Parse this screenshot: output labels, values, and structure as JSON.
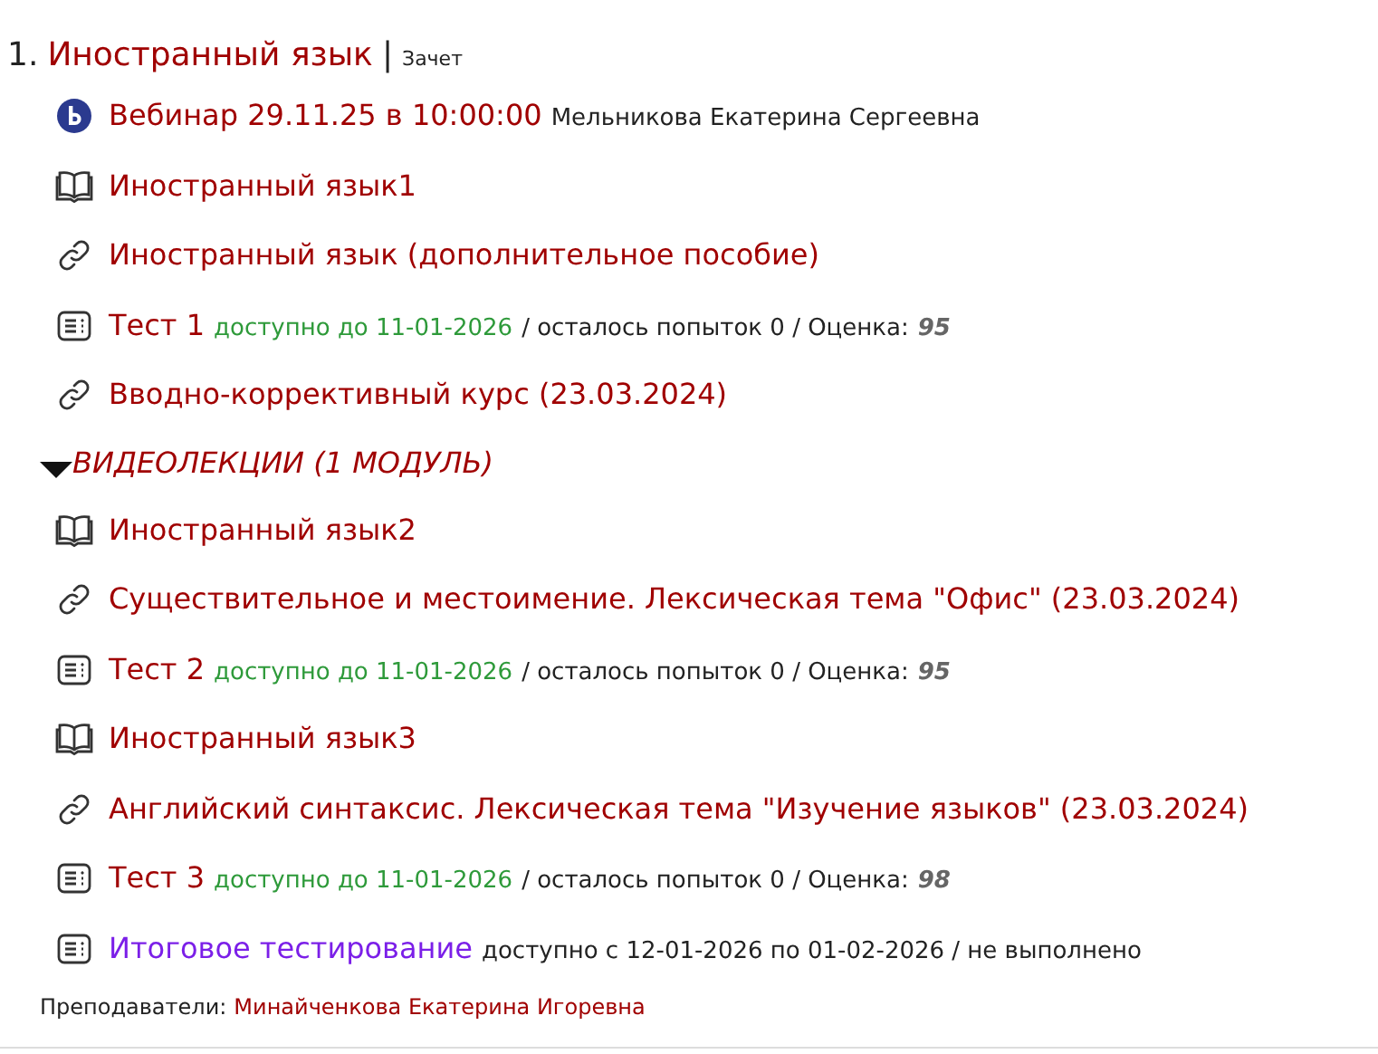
{
  "course": {
    "number": "1.",
    "title": "Иностранный язык",
    "separator": "|",
    "assessment": "Зачет"
  },
  "items": [
    {
      "kind": "webinar",
      "title": "Вебинар 29.11.25 в 10:00:00",
      "color": "#a00000",
      "note": "Мельникова Екатерина Сергеевна"
    },
    {
      "kind": "book",
      "title": "Иностранный язык1",
      "color": "#a00000"
    },
    {
      "kind": "link",
      "title": "Иностранный язык (дополнительное пособие)",
      "color": "#a00000"
    },
    {
      "kind": "test",
      "title": "Тест 1",
      "color": "#a00000",
      "available": "доступно до 11-01-2026",
      "note": "/ осталось попыток 0 / Оценка:",
      "grade": "95"
    },
    {
      "kind": "link",
      "title": "Вводно-коррективный курс (23.03.2024)",
      "color": "#a00000"
    },
    {
      "kind": "section",
      "title": "ВИДЕОЛЕКЦИИ (1 МОДУЛЬ)",
      "color": "#a00000",
      "expanded": true
    },
    {
      "kind": "book",
      "title": "Иностранный язык2",
      "color": "#a00000"
    },
    {
      "kind": "link",
      "title": "Существительное и местоимение. Лексическая тема \"Офис\" (23.03.2024)",
      "color": "#a00000"
    },
    {
      "kind": "test",
      "title": "Тест 2",
      "color": "#a00000",
      "available": "доступно до 11-01-2026",
      "note": "/ осталось попыток 0 / Оценка:",
      "grade": "95"
    },
    {
      "kind": "book",
      "title": "Иностранный язык3",
      "color": "#a00000"
    },
    {
      "kind": "link",
      "title": "Английский синтаксис. Лексическая тема \"Изучение языков\" (23.03.2024)",
      "color": "#a00000"
    },
    {
      "kind": "test",
      "title": "Тест 3",
      "color": "#a00000",
      "available": "доступно до 11-01-2026",
      "note": "/ осталось попыток 0 / Оценка:",
      "grade": "98"
    },
    {
      "kind": "test",
      "title": "Итоговое тестирование",
      "color": "#7b1fe8",
      "note": "доступно с 12-01-2026 по 01-02-2026 / не выполнено"
    }
  ],
  "teachers": {
    "label": "Преподаватели:",
    "names": "Минайченкова Екатерина Игоревна"
  }
}
